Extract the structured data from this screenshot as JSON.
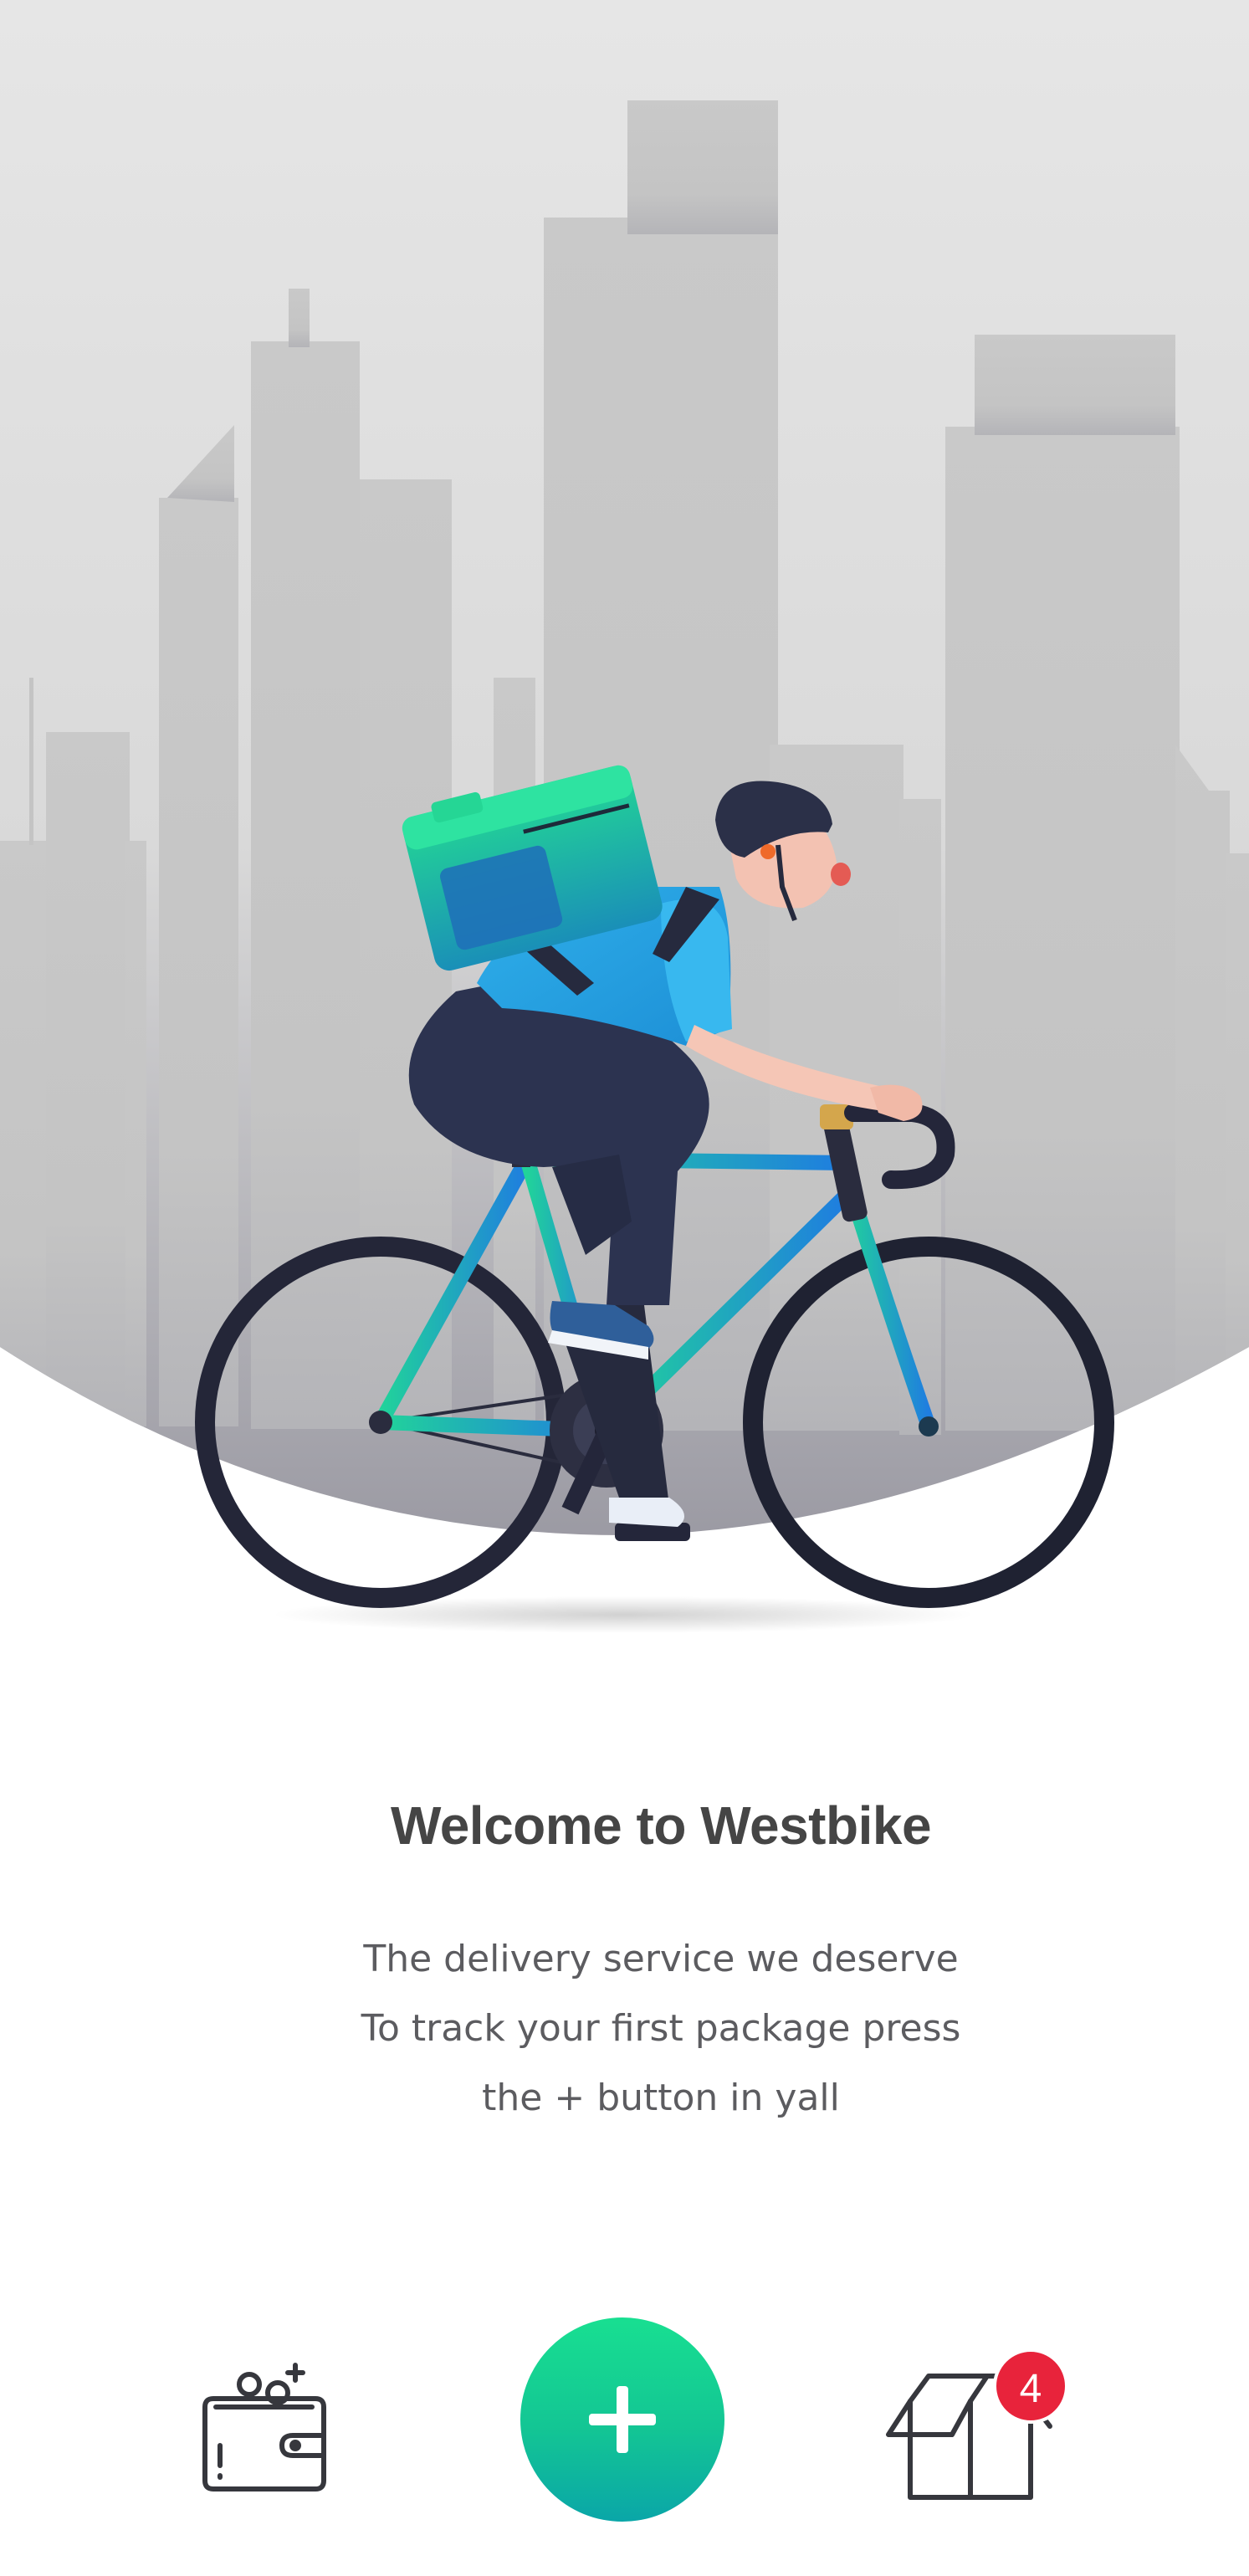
{
  "welcome": {
    "title": "Welcome to Westbike",
    "lines": [
      "The delivery service we deserve",
      "To track your first package press",
      "the + button in yall"
    ]
  },
  "bottom_bar": {
    "wallet_icon": "wallet-icon",
    "add_icon": "plus-icon",
    "packages_icon": "open-box-icon",
    "packages_badge": "4"
  },
  "colors": {
    "accent_top": "#18df91",
    "accent_bottom": "#0aa6a8",
    "badge": "#e8233b",
    "title": "#454545",
    "text": "#5c5c60"
  }
}
